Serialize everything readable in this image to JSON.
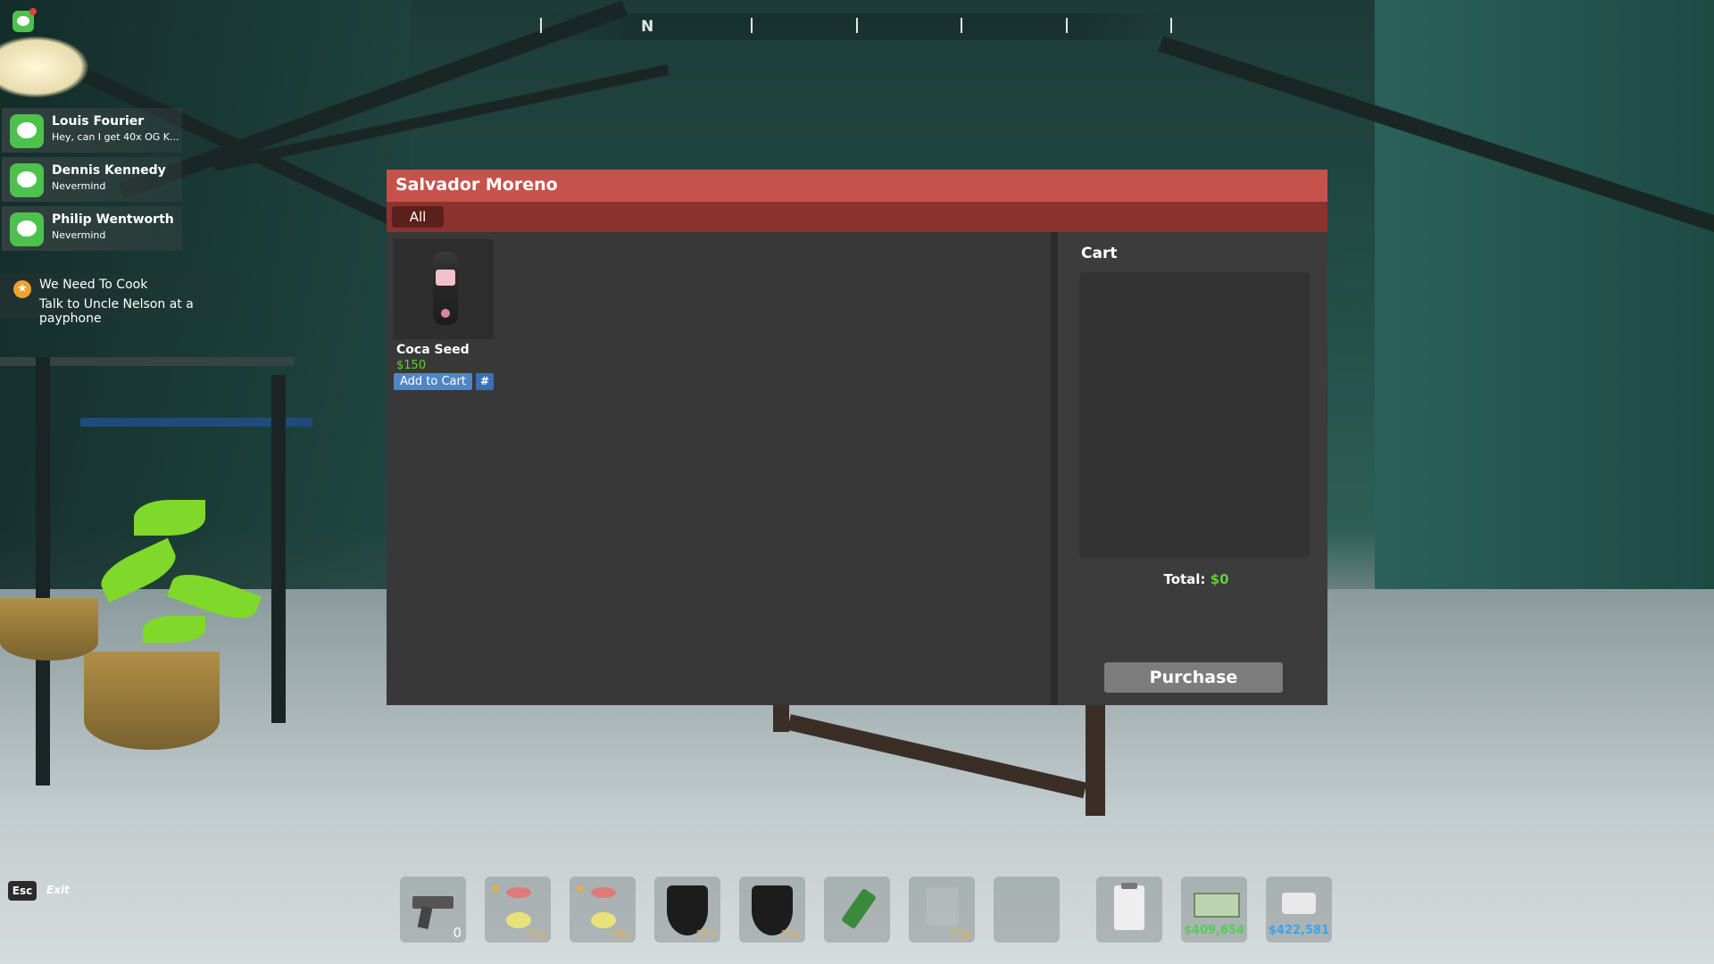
{
  "compass": {
    "heading": "N"
  },
  "notifications": [
    {
      "name": "Louis Fourier",
      "message": "Hey, can I get 40x OG K..."
    },
    {
      "name": "Dennis Kennedy",
      "message": "Nevermind"
    },
    {
      "name": "Philip Wentworth",
      "message": "Nevermind"
    }
  ],
  "quest": {
    "title": "We Need To Cook",
    "subtitle": "Talk to Uncle Nelson at a payphone"
  },
  "shop": {
    "vendor": "Salvador Moreno",
    "tabs": [
      {
        "label": "All"
      }
    ],
    "items": [
      {
        "name": "Coca Seed",
        "price": "$150",
        "add_label": "Add to Cart",
        "qty_label": "#"
      }
    ],
    "cart": {
      "title": "Cart",
      "total_label": "Total:",
      "total_value": "$0",
      "purchase_label": "Purchase"
    }
  },
  "controls": {
    "esc_key": "Esc",
    "esc_action": "Exit"
  },
  "hotbar": [
    {
      "item": "pistol",
      "quantity": "0"
    },
    {
      "item": "starred-bud",
      "quantity": "21x"
    },
    {
      "item": "starred-bud",
      "quantity": "18x"
    },
    {
      "item": "black-bag",
      "quantity": "22x"
    },
    {
      "item": "black-bag",
      "quantity": "22x"
    },
    {
      "item": "trimmers",
      "quantity": ""
    },
    {
      "item": "jar",
      "quantity": "22x"
    },
    {
      "item": "empty",
      "quantity": ""
    }
  ],
  "tools": {
    "clipboard": "clipboard-icon",
    "cash": {
      "amount": "$409,854",
      "color": "#4fd14f"
    },
    "bank": {
      "amount": "$422,581",
      "color": "#3aa6e8"
    }
  },
  "colors": {
    "header": "#c7524c",
    "tabbar": "#8c322e",
    "price_green": "#5fcf3a",
    "button_blue": "#4f86c6"
  }
}
